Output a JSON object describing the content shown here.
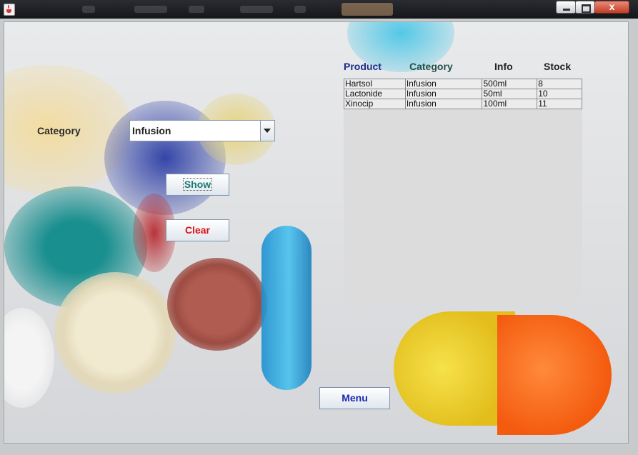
{
  "window": {
    "controls": {
      "minimize_icon": "minimize-icon",
      "maximize_icon": "maximize-icon",
      "close_label": "x"
    }
  },
  "form": {
    "category_label": "Category",
    "category_value": "Infusion",
    "show_label": "Show",
    "clear_label": "Clear",
    "menu_label": "Menu"
  },
  "table": {
    "columns": [
      "Product",
      "Category",
      "Info",
      "Stock"
    ],
    "rows": [
      [
        "Hartsol",
        "Infusion",
        "500ml",
        "8"
      ],
      [
        "Lactonide",
        "Infusion",
        "50ml",
        "10"
      ],
      [
        "Xinocip",
        "Infusion",
        "100ml",
        "11"
      ]
    ]
  },
  "colors": {
    "product_header": "#1b2b8a",
    "category_header": "#1f4f4f",
    "info_header": "#222222",
    "stock_header": "#222222",
    "show_text": "#1a7a78",
    "clear_text": "#dd1111",
    "menu_text": "#1b28b5"
  }
}
